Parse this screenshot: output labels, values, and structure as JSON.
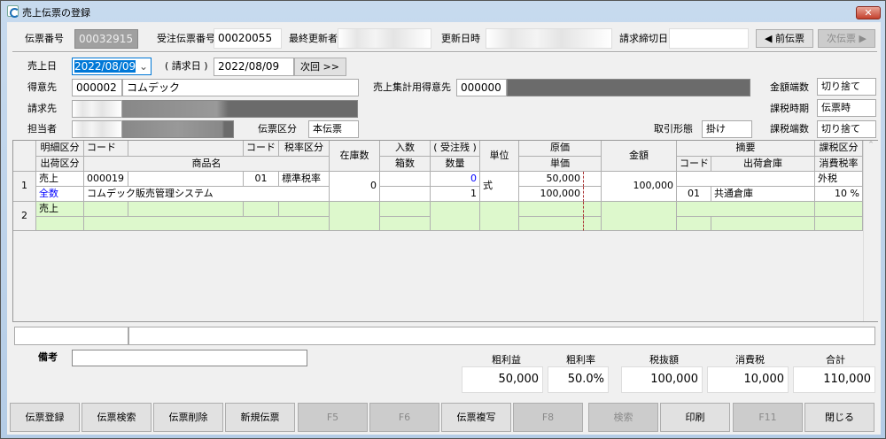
{
  "window": {
    "title": "売上伝票の登録",
    "close": "✕"
  },
  "header": {
    "slip_no_label": "伝票番号",
    "slip_no": "00032915",
    "order_no_label": "受注伝票番号",
    "order_no": "00020055",
    "updater_label": "最終更新者",
    "updated_label": "更新日時",
    "closing_label": "請求締切日",
    "closing": "",
    "prev": "◀  前伝票",
    "next": "次伝票  ▶"
  },
  "form": {
    "sale_date_label": "売上日",
    "sale_date": "2022/08/09",
    "bill_date_label": "( 請求日 )",
    "bill_date": "2022/08/09",
    "next_btn": "次回 >>",
    "customer_label": "得意先",
    "customer_code": "000002",
    "customer_name": "コムデック",
    "agg_customer_label": "売上集計用得意先",
    "agg_customer_code": "000000",
    "billto_label": "請求先",
    "staff_label": "担当者",
    "slip_type_label": "伝票区分",
    "slip_type": "本伝票",
    "trade_label": "取引形態",
    "trade": "掛け",
    "amount_round_label": "金額端数",
    "amount_round": "切り捨て",
    "tax_timing_label": "課税時期",
    "tax_timing": "伝票時",
    "tax_round_label": "課税端数",
    "tax_round": "切り捨て"
  },
  "grid": {
    "headers": {
      "detail_type": "明細区分",
      "ship_type": "出荷区分",
      "code": "コード",
      "product": "商品名",
      "code2": "コード",
      "tax_rate_type": "税率区分",
      "stock": "在庫数",
      "per_case": "入数",
      "cases": "箱数",
      "backorder": "( 受注残 )",
      "qty": "数量",
      "unit": "単位",
      "cost": "原価",
      "unit_price": "単価",
      "amount": "金額",
      "memo": "摘要",
      "memo_code": "コード",
      "warehouse": "出荷倉庫",
      "tax_type": "課税区分",
      "tax_rate": "消費税率"
    },
    "rows": [
      {
        "no": "1",
        "detail_type": "売上",
        "ship_type": "全数",
        "code": "000019",
        "product": "コムデック販売管理システム",
        "code2": "01",
        "tax_rate_type": "標準税率",
        "stock": "0",
        "backorder": "0",
        "qty": "1",
        "unit": "式",
        "cost": "50,000",
        "unit_price": "100,000",
        "amount": "100,000",
        "memo_code": "01",
        "warehouse": "共通倉庫",
        "tax_type": "外税",
        "tax_rate": "10 %"
      },
      {
        "no": "2",
        "detail_type": "売上"
      }
    ]
  },
  "remarks": {
    "label": "備考",
    "value": ""
  },
  "totals": {
    "gross_profit_label": "粗利益",
    "gross_profit": "50,000",
    "margin_label": "粗利率",
    "margin": "50.0%",
    "net_label": "税抜額",
    "net": "100,000",
    "tax_label": "消費税",
    "tax": "10,000",
    "total_label": "合計",
    "total": "110,000"
  },
  "buttons": [
    "伝票登録",
    "伝票検索",
    "伝票削除",
    "新規伝票",
    "F5",
    "F6",
    "伝票複写",
    "F8",
    "検索",
    "印刷",
    "F11",
    "閉じる"
  ],
  "colors": {
    "accent_blue": "#0000ff",
    "new_row": "#ddf8cc",
    "highlight": "#0078d7"
  }
}
